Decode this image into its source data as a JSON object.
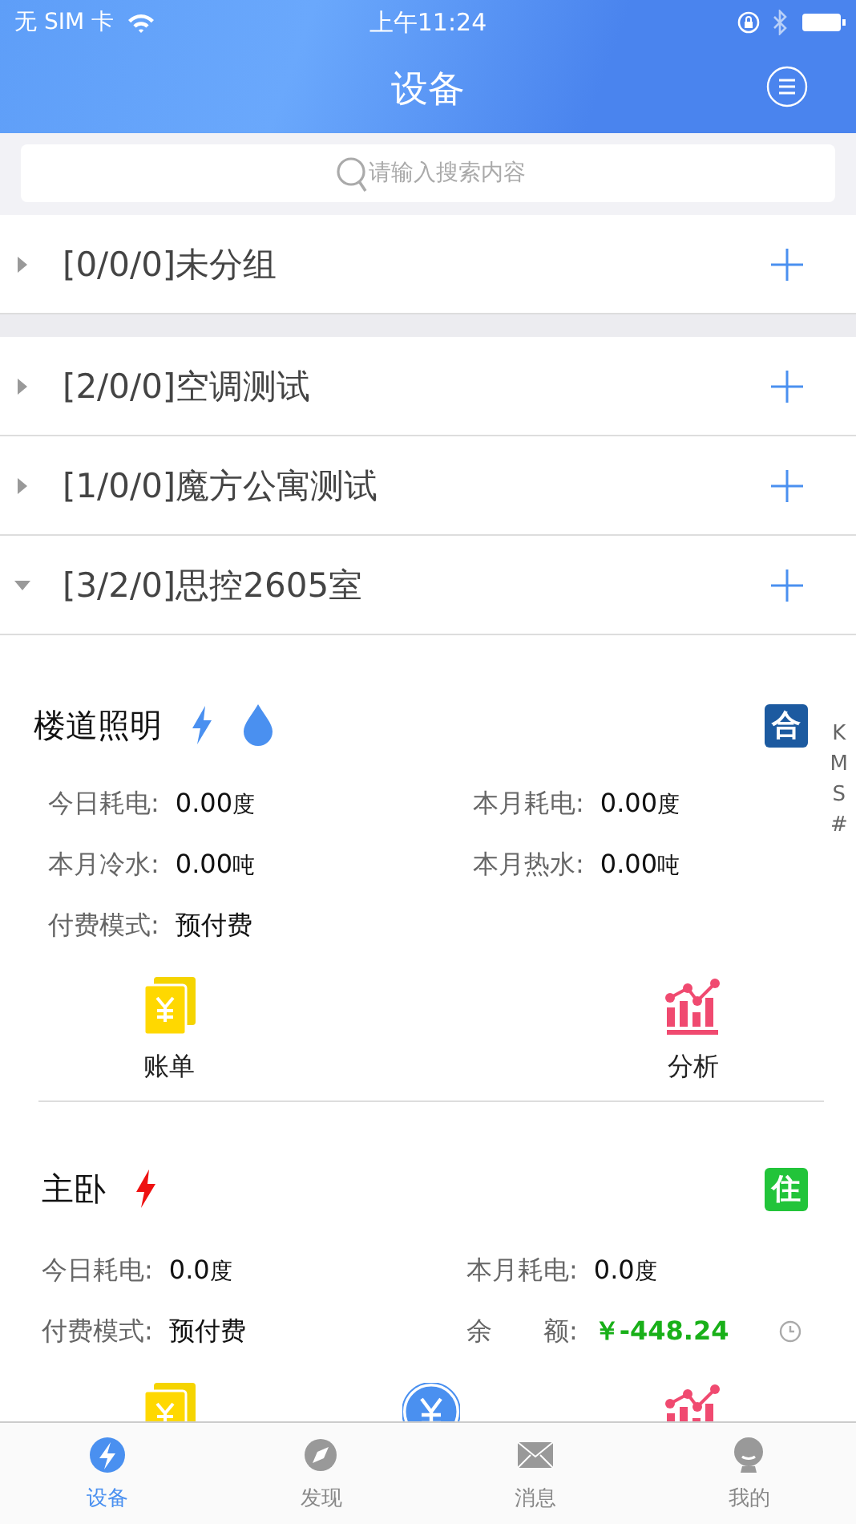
{
  "status_bar": {
    "carrier": "无 SIM 卡",
    "time": "上午11:24"
  },
  "nav": {
    "title": "设备"
  },
  "search": {
    "placeholder": "请输入搜索内容"
  },
  "sections": [
    {
      "groups": [
        {
          "name": "[0/0/0]未分组",
          "expanded": false
        }
      ]
    },
    {
      "groups": [
        {
          "name": "[2/0/0]空调测试",
          "expanded": false
        },
        {
          "name": "[1/0/0]魔方公寓测试",
          "expanded": false
        },
        {
          "name": "[3/2/0]思控2605室",
          "expanded": true
        }
      ]
    }
  ],
  "devices": [
    {
      "name": "楼道照明",
      "power_alert": false,
      "water": true,
      "badge": "合",
      "color": "#1c5aa0",
      "stats": [
        {
          "label": "今日耗电:",
          "value": "0.00",
          "unit": "度"
        },
        {
          "label": "本月耗电:",
          "value": "0.00",
          "unit": "度"
        },
        {
          "label": "本月冷水:",
          "value": "0.00",
          "unit": "吨"
        },
        {
          "label": "本月热水:",
          "value": "0.00",
          "unit": "吨"
        },
        {
          "label": "付费模式:",
          "value": "预付费"
        }
      ],
      "actions": [
        {
          "kind": "bill",
          "label": "账单"
        },
        {
          "kind": "analysis",
          "label": "分析"
        }
      ]
    },
    {
      "name": "主卧",
      "power_alert": true,
      "badge": "住",
      "color": "#22c43a",
      "stats": [
        {
          "label": "今日耗电:",
          "value": "0.0",
          "unit": "度"
        },
        {
          "label": "本月耗电:",
          "value": "0.0",
          "unit": "度"
        },
        {
          "label": "付费模式:",
          "value": "预付费"
        },
        {
          "label": "余　　额:",
          "value": "￥-448.24",
          "kind": "balance"
        }
      ],
      "actions": [
        {
          "kind": "bill"
        },
        {
          "kind": "recharge"
        },
        {
          "kind": "analysis"
        }
      ]
    }
  ],
  "index_letters": [
    "K",
    "M",
    "S",
    "#"
  ],
  "tabs": [
    {
      "label": "设备",
      "kind": "device",
      "selected": true
    },
    {
      "label": "发现",
      "kind": "discover",
      "selected": false
    },
    {
      "label": "消息",
      "kind": "message",
      "selected": false
    },
    {
      "label": "我的",
      "kind": "me",
      "selected": false
    }
  ]
}
